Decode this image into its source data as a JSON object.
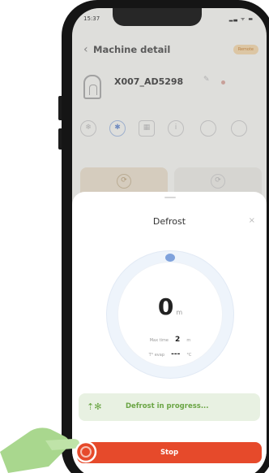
{
  "status_bar": {
    "time": "15:37",
    "icons": "▂▃ ᯤ ▬"
  },
  "header": {
    "back_symbol": "‹",
    "title": "Machine detail",
    "status_pill": "Remote"
  },
  "machine": {
    "name": "X007_AD5298",
    "edit_symbol": "✎"
  },
  "icon_strip": [
    "snowflake-icon",
    "fan-icon",
    "grid-icon",
    "info-icon",
    "circle-icon",
    "circle-icon"
  ],
  "sheet": {
    "title": "Defrost",
    "close_symbol": "×",
    "value": "0",
    "value_unit": "m",
    "max_time_label": "Max time",
    "max_time_value": "2",
    "max_time_unit": "m",
    "temp_label": "T° evap",
    "temp_value": "---",
    "temp_unit": "°C"
  },
  "banner": {
    "icon": "defrost-icon",
    "text": "Defrost in progress..."
  },
  "stop_button": {
    "label": "Stop"
  },
  "colors": {
    "accent_red": "#e64a2b",
    "progress_green": "#6aa544",
    "dial_blue": "#7fa2dc"
  }
}
